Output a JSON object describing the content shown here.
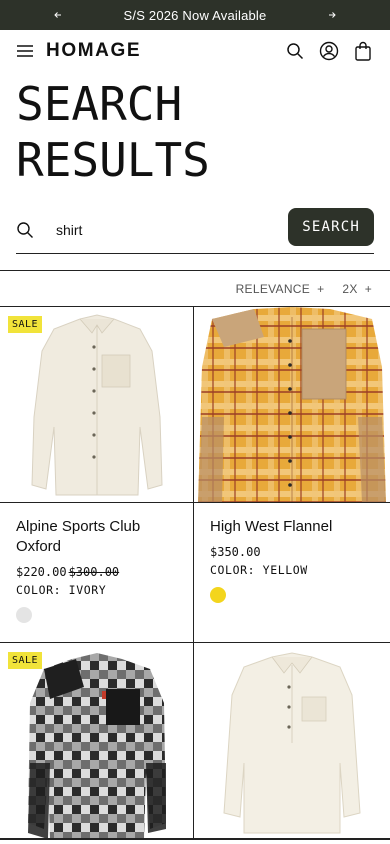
{
  "announcement": {
    "message": "S/S 2026 Now Available",
    "prev_icon": "arrow-left-icon",
    "next_icon": "arrow-right-icon"
  },
  "header": {
    "logo": "HOMAGE",
    "icons": [
      "menu-icon",
      "search-icon",
      "account-icon",
      "bag-icon"
    ]
  },
  "page": {
    "title_line1": "SEARCH",
    "title_line2": "RESULTS"
  },
  "search": {
    "value": "shirt",
    "button_label": "SEARCH"
  },
  "filters": [
    {
      "label": "RELEVANCE"
    },
    {
      "label": "2X"
    }
  ],
  "products": [
    {
      "name": "Alpine Sports Club Oxford",
      "price": "$220.00",
      "original_price": "$300.00",
      "color_label": "COLOR: IVORY",
      "badge": "SALE",
      "swatch": "#e4e4e4"
    },
    {
      "name": "High West Flannel",
      "price": "$350.00",
      "original_price": "",
      "color_label": "COLOR: YELLOW",
      "badge": "",
      "swatch": "#f3d51d"
    },
    {
      "name": "",
      "price": "",
      "original_price": "",
      "color_label": "",
      "badge": "SALE",
      "swatch": ""
    },
    {
      "name": "",
      "price": "",
      "original_price": "",
      "color_label": "",
      "badge": "",
      "swatch": ""
    }
  ],
  "colors": {
    "dark": "#2d3229",
    "sale_badge": "#f1e33a"
  }
}
